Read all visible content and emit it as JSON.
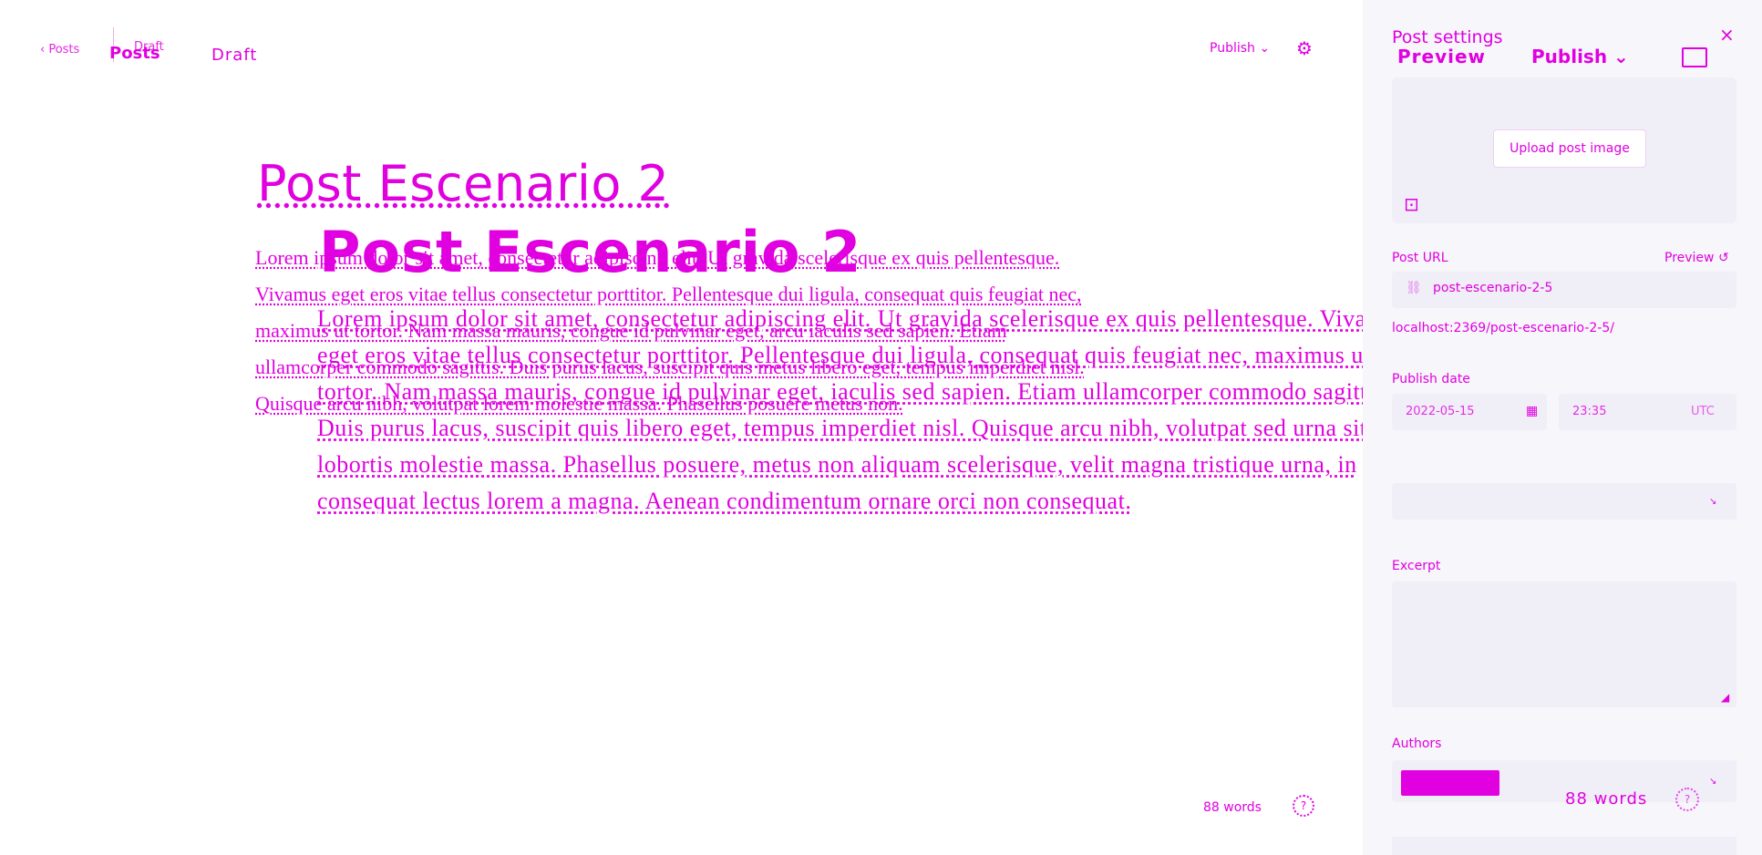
{
  "ghost": {
    "back_label": "‹ Posts",
    "draft_label": "Draft",
    "title": "Post Escenario 2",
    "body": "Lorem ipsum dolor sit amet, consectetur adipiscing elit. Ut gravida scelerisque ex quis pellentesque. Vivamus eget eros vitae tellus consectetur porttitor. Pellentesque dui ligula, consequat quis feugiat nec, maximus ut tortor. Nam massa mauris, congue id pulvinar eget, arcu iaculis sed sapien. Etiam ullamcorper commodo sagittis. Duis purus lacus, suscipit quis metus libero eget, tempus imperdiet nisl. Quisque arcu nibh, volutpat lorem molestie massa. Phasellus posuere metus non.",
    "publish_label": "Publish ⌄",
    "gear_icon": "gear-icon",
    "word_count": "88 words",
    "help_icon": "?"
  },
  "header": {
    "posts_label": "Posts",
    "draft_label": "Draft"
  },
  "editor": {
    "title": "Post Escenario 2",
    "body": "Lorem ipsum dolor sit amet, consectetur adipiscing elit. Ut gravida scelerisque ex quis pellentesque. Vivamus eget eros vitae tellus consectetur porttitor. Pellentesque dui ligula, consequat quis feugiat nec, maximus ut tortor. Nam massa mauris, congue id pulvinar eget, iaculis sed sapien. Etiam ullamcorper commodo sagittis. Duis purus lacus, suscipit quis libero eget, tempus imperdiet nisl. Quisque arcu nibh, volutpat sed urna sit amet, lobortis molestie massa. Phasellus posuere, metus non aliquam scelerisque, velit magna tristique urna, in consequat lectus lorem a magna. Aenean condimentum ornare orci non consequat."
  },
  "sidebar": {
    "title": "Post settings",
    "close_icon": "×",
    "preview_label": "Preview",
    "publish_label": "Publish ⌄",
    "toggle_icon": "sidebar-toggle-icon",
    "upload_label": "Upload post image",
    "unsplash_icon": "⊡",
    "post_url_label": "Post URL",
    "preview_link": "Preview ↺",
    "url_value": "post-escenario-2-5",
    "url_helper": "localhost:2369/post-escenario-2-5/",
    "publish_date_label": "Publish date",
    "date_value": "2022-05-15",
    "time_value": "23:35",
    "tz_value": "UTC",
    "excerpt_label": "Excerpt",
    "authors_label": "Authors",
    "author_chip": "",
    "word_count": "88 words",
    "help_icon": "?"
  },
  "colors": {
    "accent": "#e000e0",
    "sidebar_bg": "#f7f6fb"
  }
}
